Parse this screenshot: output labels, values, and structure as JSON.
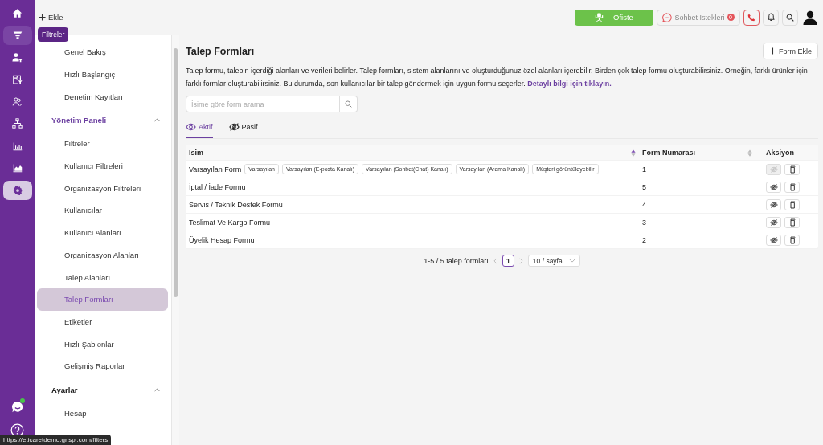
{
  "rail": {
    "items": [
      {
        "selected": false,
        "hovered": false
      },
      {
        "selected": false,
        "hovered": true
      },
      {
        "selected": false,
        "hovered": false
      },
      {
        "selected": false,
        "hovered": false
      },
      {
        "selected": false,
        "hovered": false
      },
      {
        "selected": false,
        "hovered": false
      },
      {
        "selected": false,
        "hovered": false
      },
      {
        "selected": false,
        "hovered": false
      },
      {
        "selected": true,
        "hovered": false
      }
    ],
    "tooltip": "Filtreler",
    "bottom": [
      {
        "online": true
      },
      {
        "online": false
      }
    ]
  },
  "topbar": {
    "add_label": "Ekle",
    "status_button": "Ofiste",
    "chat_requests": {
      "label": "Sohbet İstekleri",
      "count": "0"
    }
  },
  "sidebar": {
    "items": [
      {
        "label": "Genel Bakış",
        "selected": false
      },
      {
        "label": "Hızlı Başlangıç",
        "selected": false
      },
      {
        "label": "Denetim Kayıtları",
        "selected": false
      }
    ],
    "groups": [
      {
        "title": "Yönetim Paneli",
        "active": true,
        "expanded": true,
        "items": [
          {
            "label": "Filtreler",
            "selected": false
          },
          {
            "label": "Kullanıcı Filtreleri",
            "selected": false
          },
          {
            "label": "Organizasyon Filtreleri",
            "selected": false
          },
          {
            "label": "Kullanıcılar",
            "selected": false
          },
          {
            "label": "Kullanıcı Alanları",
            "selected": false
          },
          {
            "label": "Organizasyon Alanları",
            "selected": false
          },
          {
            "label": "Talep Alanları",
            "selected": false
          },
          {
            "label": "Talep Formları",
            "selected": true
          },
          {
            "label": "Etiketler",
            "selected": false
          },
          {
            "label": "Hızlı Şablonlar",
            "selected": false
          },
          {
            "label": "Gelişmiş Raporlar",
            "selected": false
          }
        ]
      },
      {
        "title": "Ayarlar",
        "active": false,
        "expanded": true,
        "items": [
          {
            "label": "Hesap",
            "selected": false
          }
        ]
      }
    ]
  },
  "main": {
    "title": "Talep Formları",
    "add_button": "Form Ekle",
    "description": "Talep formu, talebin içerdiği alanları ve verileri belirler. Talep formları, sistem alanlarını ve oluşturduğunuz özel alanları içerebilir. Birden çok talep formu oluşturabilirsiniz. Örneğin, farklı ürünler için farklı formlar oluşturabilirsiniz. Bu durumda, son kullanıcılar bir talep göndermek için uygun formu seçerler.",
    "description_link": "Detaylı bilgi için tıklayın.",
    "search": {
      "placeholder": "İsime göre form arama"
    },
    "tabs": [
      {
        "label": "Aktif",
        "selected": true
      },
      {
        "label": "Pasif",
        "selected": false
      }
    ],
    "table": {
      "columns": [
        {
          "label": "İsim",
          "sortable": true,
          "sorted_ascending": true
        },
        {
          "label": "Form Numarası",
          "sortable": true,
          "sorted_ascending": false
        },
        {
          "label": "Aksiyon"
        }
      ],
      "rows": [
        {
          "name": "Varsayılan Form",
          "tags": [
            "Varsayılan",
            "Varsayılan (E-posta Kanalı)",
            "Varsayılan (Sohbet(Chat) Kanalı)",
            "Varsayılan (Arama Kanalı)",
            "Müşteri görüntüleyebilir"
          ],
          "number": "1",
          "hide_disabled": true
        },
        {
          "name": "İptal / İade Formu",
          "number": "5",
          "hide_disabled": false
        },
        {
          "name": "Servis / Teknik Destek Formu",
          "number": "4",
          "hide_disabled": false
        },
        {
          "name": "Teslimat Ve Kargo Formu",
          "number": "3",
          "hide_disabled": false
        },
        {
          "name": "Üyelik Hesap Formu",
          "number": "2",
          "hide_disabled": false
        }
      ]
    },
    "pagination": {
      "summary": "1-5 / 5 talep formları",
      "pages": [
        {
          "label": "1",
          "selected": true
        }
      ],
      "page_size": "10 / sayfa"
    }
  },
  "status_url": "https://eticaretdemo.grispi.com/filters"
}
